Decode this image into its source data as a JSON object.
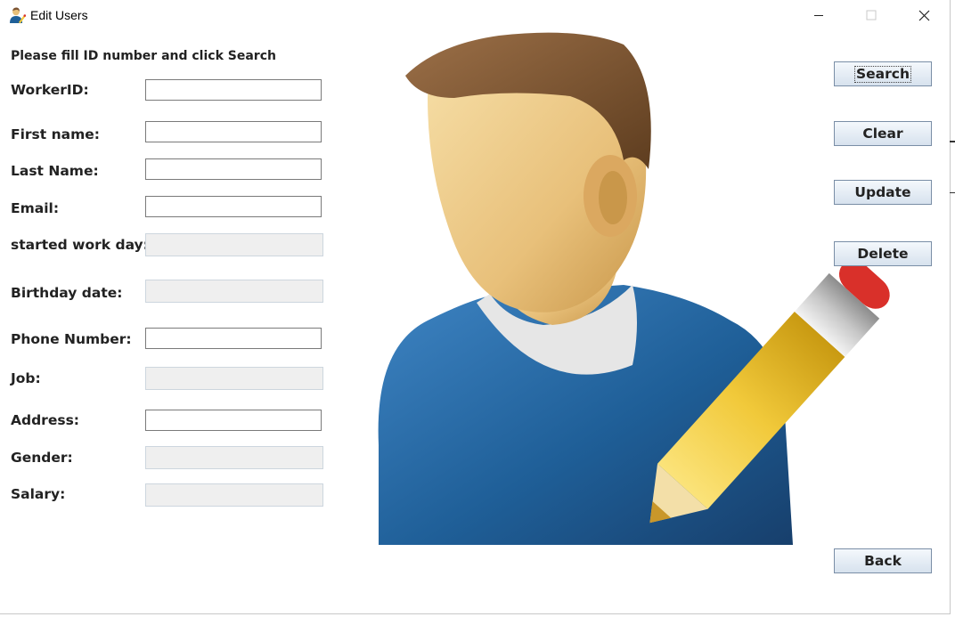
{
  "window": {
    "title": "Edit Users",
    "app_icon": "user-edit-icon"
  },
  "window_controls": {
    "minimize": "minimize-icon",
    "maximize": "maximize-icon",
    "close": "close-icon"
  },
  "form": {
    "instruction": "Please fill ID number and click Search",
    "fields": {
      "worker_id": {
        "label": "WorkerID:",
        "value": "",
        "editable": true
      },
      "first_name": {
        "label": "First name:",
        "value": "",
        "editable": true
      },
      "last_name": {
        "label": "Last Name:",
        "value": "",
        "editable": true
      },
      "email": {
        "label": "Email:",
        "value": "",
        "editable": true
      },
      "started_work_day": {
        "label": "started work day:",
        "value": "",
        "editable": false
      },
      "birthday_date": {
        "label": "Birthday date:",
        "value": "",
        "editable": false
      },
      "phone_number": {
        "label": "Phone Number:",
        "value": "",
        "editable": true
      },
      "job": {
        "label": "Job:",
        "value": "",
        "editable": false
      },
      "address": {
        "label": "Address:",
        "value": "",
        "editable": true
      },
      "gender": {
        "label": "Gender:",
        "value": "",
        "editable": false
      },
      "salary": {
        "label": "Salary:",
        "value": "",
        "editable": false
      }
    }
  },
  "buttons": {
    "search": "Search",
    "clear": "Clear",
    "update": "Update",
    "delete": "Delete",
    "back": "Back"
  },
  "illustration": {
    "icon": "user-with-pencil-illustration"
  },
  "colors": {
    "shirt": "#1f5f98",
    "hair": "#7b5230",
    "skin": "#e8c07a",
    "pencil": "#f1c93a",
    "eraser": "#d9302a",
    "button_border": "#7a8ea6"
  }
}
